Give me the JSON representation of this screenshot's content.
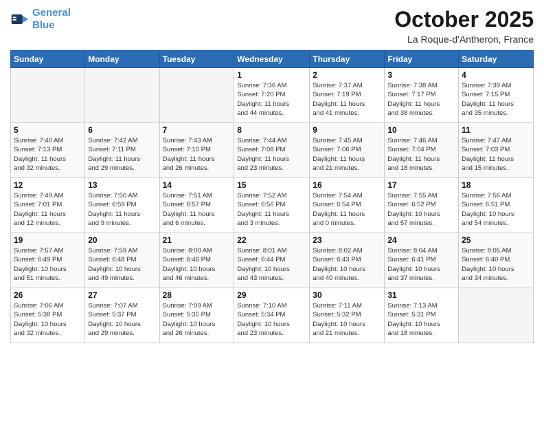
{
  "header": {
    "logo_line1": "General",
    "logo_line2": "Blue",
    "month": "October 2025",
    "location": "La Roque-d'Antheron, France"
  },
  "weekdays": [
    "Sunday",
    "Monday",
    "Tuesday",
    "Wednesday",
    "Thursday",
    "Friday",
    "Saturday"
  ],
  "weeks": [
    [
      {
        "day": "",
        "info": ""
      },
      {
        "day": "",
        "info": ""
      },
      {
        "day": "",
        "info": ""
      },
      {
        "day": "1",
        "info": "Sunrise: 7:36 AM\nSunset: 7:20 PM\nDaylight: 11 hours\nand 44 minutes."
      },
      {
        "day": "2",
        "info": "Sunrise: 7:37 AM\nSunset: 7:19 PM\nDaylight: 11 hours\nand 41 minutes."
      },
      {
        "day": "3",
        "info": "Sunrise: 7:38 AM\nSunset: 7:17 PM\nDaylight: 11 hours\nand 38 minutes."
      },
      {
        "day": "4",
        "info": "Sunrise: 7:39 AM\nSunset: 7:15 PM\nDaylight: 11 hours\nand 35 minutes."
      }
    ],
    [
      {
        "day": "5",
        "info": "Sunrise: 7:40 AM\nSunset: 7:13 PM\nDaylight: 11 hours\nand 32 minutes."
      },
      {
        "day": "6",
        "info": "Sunrise: 7:42 AM\nSunset: 7:11 PM\nDaylight: 11 hours\nand 29 minutes."
      },
      {
        "day": "7",
        "info": "Sunrise: 7:43 AM\nSunset: 7:10 PM\nDaylight: 11 hours\nand 26 minutes."
      },
      {
        "day": "8",
        "info": "Sunrise: 7:44 AM\nSunset: 7:08 PM\nDaylight: 11 hours\nand 23 minutes."
      },
      {
        "day": "9",
        "info": "Sunrise: 7:45 AM\nSunset: 7:06 PM\nDaylight: 11 hours\nand 21 minutes."
      },
      {
        "day": "10",
        "info": "Sunrise: 7:46 AM\nSunset: 7:04 PM\nDaylight: 11 hours\nand 18 minutes."
      },
      {
        "day": "11",
        "info": "Sunrise: 7:47 AM\nSunset: 7:03 PM\nDaylight: 11 hours\nand 15 minutes."
      }
    ],
    [
      {
        "day": "12",
        "info": "Sunrise: 7:49 AM\nSunset: 7:01 PM\nDaylight: 11 hours\nand 12 minutes."
      },
      {
        "day": "13",
        "info": "Sunrise: 7:50 AM\nSunset: 6:59 PM\nDaylight: 11 hours\nand 9 minutes."
      },
      {
        "day": "14",
        "info": "Sunrise: 7:51 AM\nSunset: 6:57 PM\nDaylight: 11 hours\nand 6 minutes."
      },
      {
        "day": "15",
        "info": "Sunrise: 7:52 AM\nSunset: 6:56 PM\nDaylight: 11 hours\nand 3 minutes."
      },
      {
        "day": "16",
        "info": "Sunrise: 7:54 AM\nSunset: 6:54 PM\nDaylight: 11 hours\nand 0 minutes."
      },
      {
        "day": "17",
        "info": "Sunrise: 7:55 AM\nSunset: 6:52 PM\nDaylight: 10 hours\nand 57 minutes."
      },
      {
        "day": "18",
        "info": "Sunrise: 7:56 AM\nSunset: 6:51 PM\nDaylight: 10 hours\nand 54 minutes."
      }
    ],
    [
      {
        "day": "19",
        "info": "Sunrise: 7:57 AM\nSunset: 6:49 PM\nDaylight: 10 hours\nand 51 minutes."
      },
      {
        "day": "20",
        "info": "Sunrise: 7:59 AM\nSunset: 6:48 PM\nDaylight: 10 hours\nand 49 minutes."
      },
      {
        "day": "21",
        "info": "Sunrise: 8:00 AM\nSunset: 6:46 PM\nDaylight: 10 hours\nand 46 minutes."
      },
      {
        "day": "22",
        "info": "Sunrise: 8:01 AM\nSunset: 6:44 PM\nDaylight: 10 hours\nand 43 minutes."
      },
      {
        "day": "23",
        "info": "Sunrise: 8:02 AM\nSunset: 6:43 PM\nDaylight: 10 hours\nand 40 minutes."
      },
      {
        "day": "24",
        "info": "Sunrise: 8:04 AM\nSunset: 6:41 PM\nDaylight: 10 hours\nand 37 minutes."
      },
      {
        "day": "25",
        "info": "Sunrise: 8:05 AM\nSunset: 6:40 PM\nDaylight: 10 hours\nand 34 minutes."
      }
    ],
    [
      {
        "day": "26",
        "info": "Sunrise: 7:06 AM\nSunset: 5:38 PM\nDaylight: 10 hours\nand 32 minutes."
      },
      {
        "day": "27",
        "info": "Sunrise: 7:07 AM\nSunset: 5:37 PM\nDaylight: 10 hours\nand 29 minutes."
      },
      {
        "day": "28",
        "info": "Sunrise: 7:09 AM\nSunset: 5:35 PM\nDaylight: 10 hours\nand 26 minutes."
      },
      {
        "day": "29",
        "info": "Sunrise: 7:10 AM\nSunset: 5:34 PM\nDaylight: 10 hours\nand 23 minutes."
      },
      {
        "day": "30",
        "info": "Sunrise: 7:11 AM\nSunset: 5:32 PM\nDaylight: 10 hours\nand 21 minutes."
      },
      {
        "day": "31",
        "info": "Sunrise: 7:13 AM\nSunset: 5:31 PM\nDaylight: 10 hours\nand 18 minutes."
      },
      {
        "day": "",
        "info": ""
      }
    ]
  ]
}
